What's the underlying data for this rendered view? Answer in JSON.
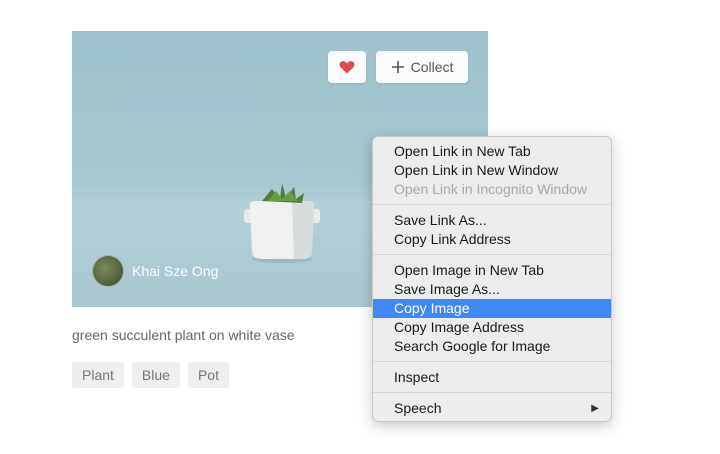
{
  "photo": {
    "like_icon": "heart-icon",
    "like_color": "#e34b4b",
    "collect_label": "Collect",
    "collect_icon": "plus-icon",
    "author_name": "Khai Sze Ong"
  },
  "caption": "green succulent plant on white vase",
  "tags": [
    "Plant",
    "Blue",
    "Pot"
  ],
  "context_menu": {
    "items": [
      {
        "label": "Open Link in New Tab"
      },
      {
        "label": "Open Link in New Window"
      },
      {
        "label": "Open Link in Incognito Window",
        "disabled": true
      },
      {
        "label": "Save Link As..."
      },
      {
        "label": "Copy Link Address"
      },
      {
        "label": "Open Image in New Tab"
      },
      {
        "label": "Save Image As..."
      },
      {
        "label": "Copy Image",
        "selected": true
      },
      {
        "label": "Copy Image Address"
      },
      {
        "label": "Search Google for Image"
      },
      {
        "label": "Inspect"
      },
      {
        "label": "Speech",
        "submenu": true
      }
    ],
    "selection_color": "#3f88f6"
  }
}
